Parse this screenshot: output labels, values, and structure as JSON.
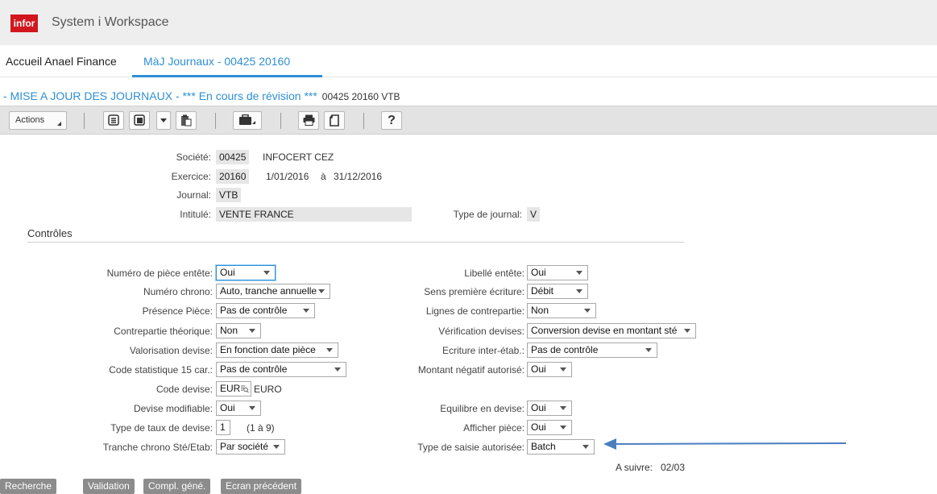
{
  "header": {
    "logo": "infor",
    "app_title": "System i Workspace"
  },
  "tabs": [
    {
      "label": "Accueil Anael Finance"
    },
    {
      "label": "MàJ Journaux - 00425 20160"
    }
  ],
  "page": {
    "heading": "- MISE A JOUR DES JOURNAUX - *** En cours de révision ***",
    "heading_sub": "00425 20160 VTB"
  },
  "toolbar": {
    "actions_label": "Actions",
    "icons": [
      "list-icon",
      "copy-icon",
      "dropdown-icon",
      "paste-icon",
      "briefcase-icon",
      "print-icon",
      "export-icon",
      "help-icon"
    ],
    "help_label": "?"
  },
  "header_fields": {
    "societe_label": "Société:",
    "societe_code": "00425",
    "societe_name": "INFOCERT CEZ",
    "exercice_label": "Exercice:",
    "exercice_code": "20160",
    "exercice_start": "1/01/2016",
    "exercice_to": "à",
    "exercice_end": "31/12/2016",
    "journal_label": "Journal:",
    "journal_value": "VTB",
    "intitule_label": "Intitulé:",
    "intitule_value": "VENTE FRANCE",
    "type_journal_label": "Type de journal:",
    "type_journal_value": "V"
  },
  "section": {
    "title": "Contrôles"
  },
  "left_fields": {
    "num_piece_label": "Numéro de pièce entête:",
    "num_piece_value": "Oui",
    "num_chrono_label": "Numéro chrono:",
    "num_chrono_value": "Auto, tranche annuelle",
    "presence_piece_label": "Présence Pièce:",
    "presence_piece_value": "Pas de contrôle",
    "contrepartie_label": "Contrepartie théorique:",
    "contrepartie_value": "Non",
    "valorisation_label": "Valorisation devise:",
    "valorisation_value": "En fonction date pièce",
    "code_stat_label": "Code statistique 15 car.:",
    "code_stat_value": "Pas de contrôle",
    "code_devise_label": "Code devise:",
    "code_devise_value": "EUR",
    "code_devise_name": "EURO",
    "devise_modif_label": "Devise modifiable:",
    "devise_modif_value": "Oui",
    "type_taux_label": "Type de taux de devise:",
    "type_taux_value": "1",
    "type_taux_range": "(1 à 9)",
    "tranche_label": "Tranche chrono Sté/Etab:",
    "tranche_value": "Par société"
  },
  "right_fields": {
    "libelle_label": "Libellé entête:",
    "libelle_value": "Oui",
    "sens_label": "Sens première écriture:",
    "sens_value": "Débit",
    "lignes_label": "Lignes de contrepartie:",
    "lignes_value": "Non",
    "verif_label": "Vérification devises:",
    "verif_value": "Conversion devise en montant sté",
    "ecriture_label": "Ecriture inter-étab.:",
    "ecriture_value": "Pas de contrôle",
    "montant_label": "Montant négatif autorisé:",
    "montant_value": "Oui",
    "equilibre_label": "Equilibre en devise:",
    "equilibre_value": "Oui",
    "afficher_label": "Afficher pièce:",
    "afficher_value": "Oui",
    "type_saisie_label": "Type de saisie autorisée:",
    "type_saisie_value": "Batch"
  },
  "pagination": {
    "label": "A suivre:",
    "value": "02/03"
  },
  "footer": {
    "recherche": "Recherche",
    "validation": "Validation",
    "compl": "Compl. géné.",
    "ecran": "Ecran précédent"
  },
  "colors": {
    "accent": "#2f8fd6",
    "brand": "#d2161e",
    "annotation_arrow": "#4a7ebf"
  }
}
